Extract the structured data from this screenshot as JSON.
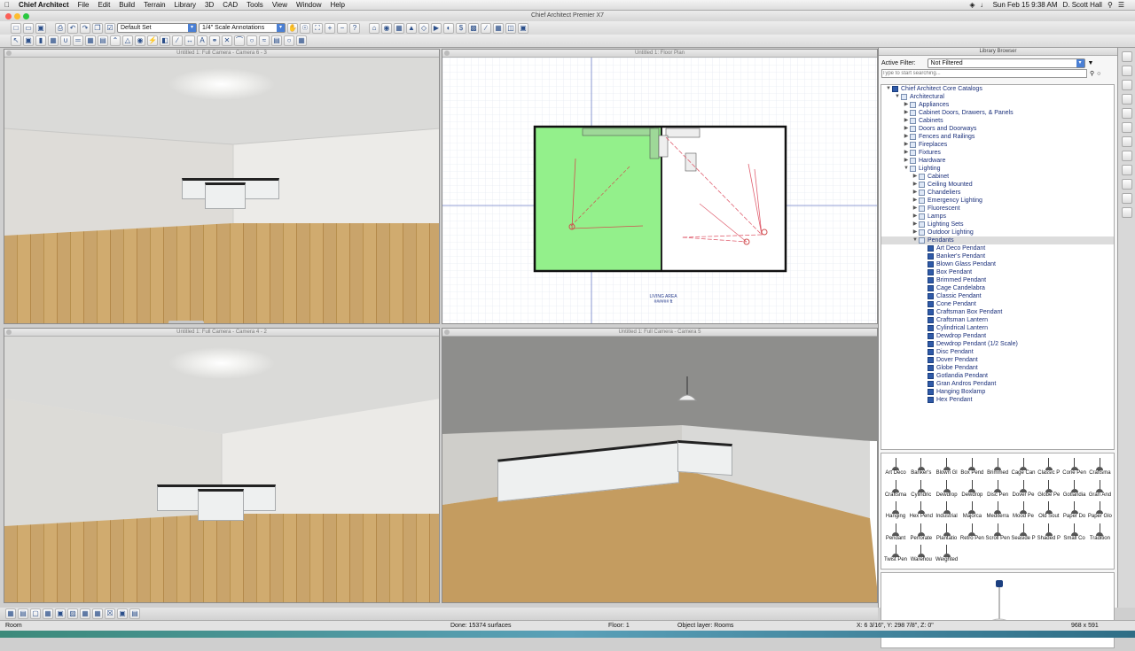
{
  "menubar": {
    "app_name": "Chief Architect",
    "items": [
      "File",
      "Edit",
      "Build",
      "Terrain",
      "Library",
      "3D",
      "CAD",
      "Tools",
      "View",
      "Window",
      "Help"
    ],
    "clock": "Sun Feb 15  9:38 AM",
    "user": "D. Scott Hall"
  },
  "window": {
    "title": "Chief Architect Premier X7"
  },
  "toolbar": {
    "layer_set": "Default Set",
    "annotation_set": "1/4\" Scale Annotations"
  },
  "views": [
    {
      "title": "Untitled 1: Full Camera - Camera 6 - 3"
    },
    {
      "title": "Untitled 1: Floor Plan"
    },
    {
      "title": "Untitled 1: Full Camera - Camera 4 - 2"
    },
    {
      "title": "Untitled 1: Full Camera - Camera 5"
    }
  ],
  "floorplan": {
    "room_label": "LIVING AREA",
    "room_sub": "###### ft"
  },
  "library": {
    "title": "Library Browser",
    "filter_label": "Active Filter:",
    "filter_value": "Not Filtered",
    "search_placeholder": "Type to start searching...",
    "tree": [
      {
        "label": "Chief Architect Core Catalogs",
        "level": 0,
        "open": true
      },
      {
        "label": "Architectural",
        "level": 1,
        "open": true
      },
      {
        "label": "Appliances",
        "level": 2
      },
      {
        "label": "Cabinet Doors, Drawers, & Panels",
        "level": 2
      },
      {
        "label": "Cabinets",
        "level": 2
      },
      {
        "label": "Doors and Doorways",
        "level": 2
      },
      {
        "label": "Fences and Railings",
        "level": 2
      },
      {
        "label": "Fireplaces",
        "level": 2
      },
      {
        "label": "Fixtures",
        "level": 2
      },
      {
        "label": "Hardware",
        "level": 2
      },
      {
        "label": "Lighting",
        "level": 2,
        "open": true
      },
      {
        "label": "Cabinet",
        "level": 3
      },
      {
        "label": "Ceiling Mounted",
        "level": 3
      },
      {
        "label": "Chandeliers",
        "level": 3
      },
      {
        "label": "Emergency Lighting",
        "level": 3
      },
      {
        "label": "Fluorescent",
        "level": 3
      },
      {
        "label": "Lamps",
        "level": 3
      },
      {
        "label": "Lighting Sets",
        "level": 3
      },
      {
        "label": "Outdoor Lighting",
        "level": 3
      },
      {
        "label": "Pendants",
        "level": 3,
        "open": true,
        "selected": true
      },
      {
        "label": "Art Deco Pendant",
        "level": 4,
        "leaf": true
      },
      {
        "label": "Banker's Pendant",
        "level": 4,
        "leaf": true
      },
      {
        "label": "Blown Glass Pendant",
        "level": 4,
        "leaf": true
      },
      {
        "label": "Box Pendant",
        "level": 4,
        "leaf": true
      },
      {
        "label": "Brimmed Pendant",
        "level": 4,
        "leaf": true
      },
      {
        "label": "Cage Candelabra",
        "level": 4,
        "leaf": true
      },
      {
        "label": "Classic Pendant",
        "level": 4,
        "leaf": true
      },
      {
        "label": "Cone Pendant",
        "level": 4,
        "leaf": true
      },
      {
        "label": "Craftsman Box Pendant",
        "level": 4,
        "leaf": true
      },
      {
        "label": "Craftsman Lantern",
        "level": 4,
        "leaf": true
      },
      {
        "label": "Cylindrical Lantern",
        "level": 4,
        "leaf": true
      },
      {
        "label": "Dewdrop Pendant",
        "level": 4,
        "leaf": true
      },
      {
        "label": "Dewdrop Pendant (1/2 Scale)",
        "level": 4,
        "leaf": true
      },
      {
        "label": "Disc Pendant",
        "level": 4,
        "leaf": true
      },
      {
        "label": "Dover Pendant",
        "level": 4,
        "leaf": true
      },
      {
        "label": "Globe Pendant",
        "level": 4,
        "leaf": true
      },
      {
        "label": "Gotlandia Pendant",
        "level": 4,
        "leaf": true
      },
      {
        "label": "Gran Andros Pendant",
        "level": 4,
        "leaf": true
      },
      {
        "label": "Hanging Boxlamp",
        "level": 4,
        "leaf": true
      },
      {
        "label": "Hex Pendant",
        "level": 4,
        "leaf": true
      }
    ],
    "thumbnails": [
      "Art Deco",
      "Banker's",
      "Blown Gl",
      "Box Pend",
      "Brimmed",
      "Cage Can",
      "Classic P",
      "Cone Pen",
      "Craftsma",
      "Craftsma",
      "Cylindric",
      "Dewdrop",
      "Dewdrop",
      "Disc Pen",
      "Dover Pe",
      "Globe Pe",
      "Gotlandia",
      "Gran And",
      "Hanging",
      "Hex Pend",
      "Industrial",
      "Majorca",
      "Mediterra",
      "Mood Pe",
      "Old Sout",
      "Paper Do",
      "Paper Glo",
      "Pendant",
      "Perforate",
      "Plantatio",
      "Retro Pen",
      "Scroll Pen",
      "Seaside P",
      "Shaded P",
      "Small Co",
      "Tradition",
      "Twist Pen",
      "Warehou",
      "Weighted"
    ]
  },
  "status": {
    "mode": "Room",
    "progress": "Done:  15374 surfaces",
    "floor": "Floor: 1",
    "layer": "Object layer: Rooms",
    "coords": "X: 6 3/16\", Y: 298 7/8\", Z: 0\"",
    "size": "968 x 591"
  },
  "colors": {
    "room_fill": "#93f08b",
    "wall": "#222222",
    "accent": "#4a7fd4"
  }
}
